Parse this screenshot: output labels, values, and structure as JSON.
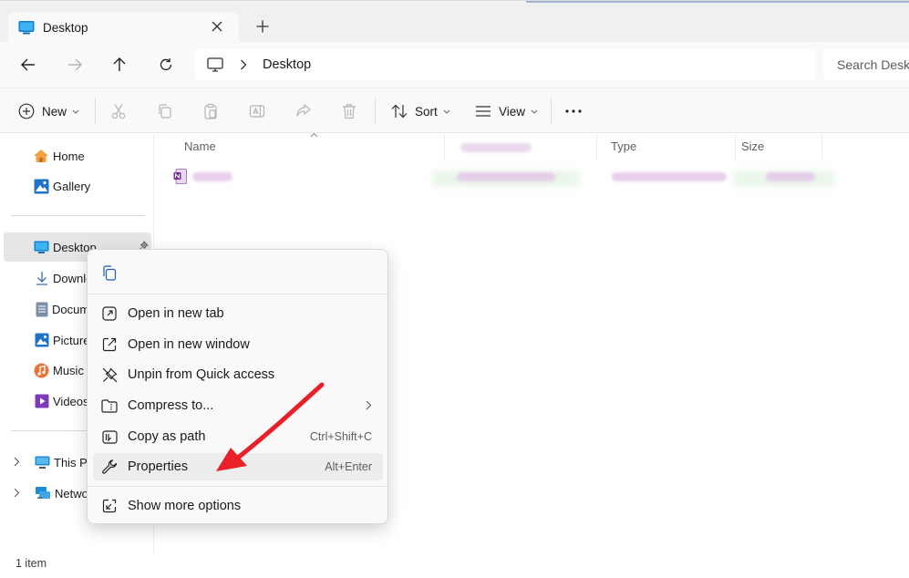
{
  "window": {
    "tab_title": "Desktop",
    "tab_close_icon": "close-icon",
    "new_tab_icon": "plus-icon"
  },
  "address_bar": {
    "location": "Desktop",
    "search_placeholder": "Search Desktop"
  },
  "command_bar": {
    "new_label": "New",
    "sort_label": "Sort",
    "view_label": "View"
  },
  "sidebar": {
    "items": [
      {
        "label": "Home",
        "icon": "home-icon"
      },
      {
        "label": "Gallery",
        "icon": "gallery-icon"
      },
      {
        "label": "Desktop",
        "icon": "desktop-folder-icon"
      },
      {
        "label": "Downloads",
        "icon": "download-icon"
      },
      {
        "label": "Documents",
        "icon": "documents-icon"
      },
      {
        "label": "Pictures",
        "icon": "pictures-icon"
      },
      {
        "label": "Music",
        "icon": "music-icon"
      },
      {
        "label": "Videos",
        "icon": "videos-icon"
      },
      {
        "label": "This PC",
        "icon": "computer-icon"
      },
      {
        "label": "Network",
        "icon": "network-icon"
      }
    ]
  },
  "file_list": {
    "columns": {
      "name": "Name",
      "type": "Type",
      "size": "Size"
    },
    "rows": [
      {
        "icon": "onenote-file-icon"
      }
    ]
  },
  "status": {
    "item_count": "1 item"
  },
  "context_menu": {
    "items": [
      {
        "label": "Open in new tab",
        "icon": "open-new-tab-icon",
        "shortcut": ""
      },
      {
        "label": "Open in new window",
        "icon": "open-new-window-icon",
        "shortcut": ""
      },
      {
        "label": "Unpin from Quick access",
        "icon": "unpin-icon",
        "shortcut": ""
      },
      {
        "label": "Compress to...",
        "icon": "compress-folder-icon",
        "shortcut": ""
      },
      {
        "label": "Copy as path",
        "icon": "copy-path-icon",
        "shortcut": "Ctrl+Shift+C"
      },
      {
        "label": "Properties",
        "icon": "wrench-icon",
        "shortcut": "Alt+Enter"
      },
      {
        "label": "Show more options",
        "icon": "show-more-icon",
        "shortcut": ""
      }
    ]
  },
  "annotation": {
    "arrow_color": "#e8202a"
  },
  "colors": {
    "accent": "#0067c0",
    "window_bg": "#f9f9f9",
    "selected_bg": "#e5e5e5",
    "menu_hover": "#ededed"
  }
}
